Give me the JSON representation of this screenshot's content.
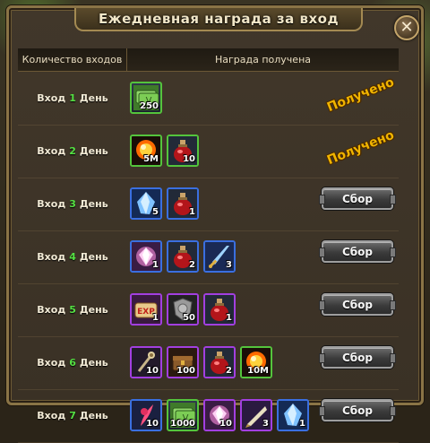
{
  "window": {
    "title": "Ежедневная награда за вход"
  },
  "header": {
    "col_logins": "Количество входов",
    "col_reward": "Награда получена"
  },
  "rows": [
    {
      "prefix": "Вход",
      "num": "1",
      "suffix": "День",
      "status": "Получено",
      "collect_label": "",
      "items": [
        {
          "icon": "bills-icon",
          "qty": "250",
          "rarity": "green"
        }
      ]
    },
    {
      "prefix": "Вход",
      "num": "2",
      "suffix": "День",
      "status": "Получено",
      "collect_label": "",
      "items": [
        {
          "icon": "orb-icon",
          "qty": "5M",
          "rarity": "green"
        },
        {
          "icon": "potion-icon",
          "qty": "10",
          "rarity": "green"
        }
      ]
    },
    {
      "prefix": "Вход",
      "num": "3",
      "suffix": "День",
      "status": "",
      "collect_label": "Сбор",
      "items": [
        {
          "icon": "crystal-icon",
          "qty": "5",
          "rarity": "blue"
        },
        {
          "icon": "potion-icon",
          "qty": "1",
          "rarity": "blue"
        }
      ]
    },
    {
      "prefix": "Вход",
      "num": "4",
      "suffix": "День",
      "status": "",
      "collect_label": "Сбор",
      "items": [
        {
          "icon": "gem-icon",
          "qty": "1",
          "rarity": "blue"
        },
        {
          "icon": "potion-icon",
          "qty": "2",
          "rarity": "blue"
        },
        {
          "icon": "sword-icon",
          "qty": "3",
          "rarity": "blue"
        }
      ]
    },
    {
      "prefix": "Вход",
      "num": "5",
      "suffix": "День",
      "status": "",
      "collect_label": "Сбор",
      "items": [
        {
          "icon": "exp-scroll-icon",
          "qty": "1",
          "rarity": "purple"
        },
        {
          "icon": "shield-icon",
          "qty": "50",
          "rarity": "purple"
        },
        {
          "icon": "potion-icon",
          "qty": "1",
          "rarity": "purple"
        }
      ]
    },
    {
      "prefix": "Вход",
      "num": "6",
      "suffix": "День",
      "status": "",
      "collect_label": "Сбор",
      "items": [
        {
          "icon": "scepter-icon",
          "qty": "10",
          "rarity": "purple"
        },
        {
          "icon": "chest-icon",
          "qty": "100",
          "rarity": "purple"
        },
        {
          "icon": "potion-icon",
          "qty": "2",
          "rarity": "purple"
        },
        {
          "icon": "orb-icon",
          "qty": "10M",
          "rarity": "green"
        }
      ]
    },
    {
      "prefix": "Вход",
      "num": "7",
      "suffix": "День",
      "status": "",
      "collect_label": "Сбор",
      "items": [
        {
          "icon": "feather-icon",
          "qty": "10",
          "rarity": "blue"
        },
        {
          "icon": "bills-icon",
          "qty": "1000",
          "rarity": "green"
        },
        {
          "icon": "gem-icon",
          "qty": "10",
          "rarity": "purple"
        },
        {
          "icon": "blade-icon",
          "qty": "3",
          "rarity": "purple"
        },
        {
          "icon": "crystal-icon",
          "qty": "1",
          "rarity": "blue"
        }
      ]
    }
  ]
}
